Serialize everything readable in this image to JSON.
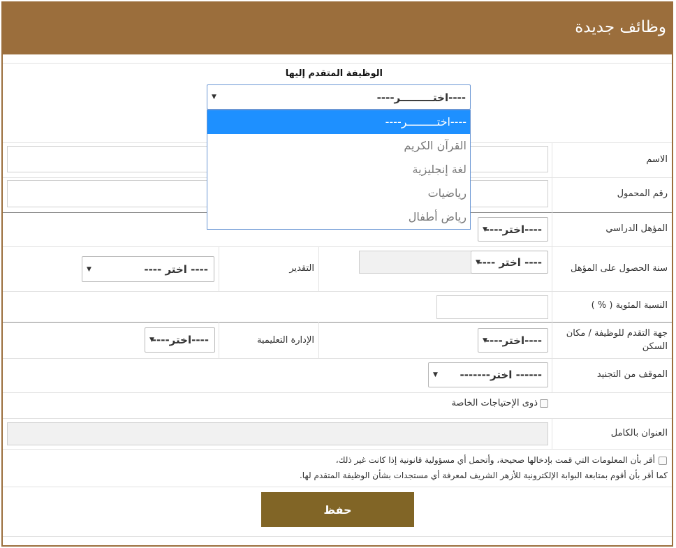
{
  "header": {
    "title": "وظائف جديدة"
  },
  "job": {
    "label": "الوظيفة المتقدم إليها",
    "selected": "----اختـــــــــر----",
    "options": [
      "----اختـــــــــر----",
      "القرآن الكريم",
      "لغة إنجليزية",
      "رياضيات",
      "رياض أطفال"
    ]
  },
  "fields": {
    "name_label": "الاسم",
    "mobile_label": "رقم المحمول",
    "qualification_label": "المؤهل الدراسي",
    "qualification_select": "----اختر----",
    "grad_year_label": "سنة الحصول على المؤهل",
    "grad_year_select": "---- اختر ----",
    "grade_label": "التقدير",
    "grade_select": "---- اختر ----",
    "percentage_label": "النسبة المئوية ( % )",
    "location_label": "جهة التقدم للوظيفة / مكان السكن",
    "location_select": "----اختر----",
    "edu_admin_label": "الإدارة التعليمية",
    "edu_admin_select": "----اختر----",
    "military_label": "الموقف من التجنيد",
    "military_select": "------ اختر-------",
    "special_needs_label": "ذوى الإحتياجات الخاصة",
    "address_label": "العنوان بالكامل"
  },
  "declaration": {
    "line1": "أقر بأن المعلومات التي قمت بإدخالها صحيحة، وأتحمل أي مسؤولية قانونية إذا كانت غير ذلك،",
    "line2": "كما أقر بأن أقوم بمتابعة البوابة الإلكترونية للأزهر الشريف لمعرفة أي مستجدات بشأن الوظيفة المتقدم لها."
  },
  "actions": {
    "save_label": "حفظ"
  }
}
